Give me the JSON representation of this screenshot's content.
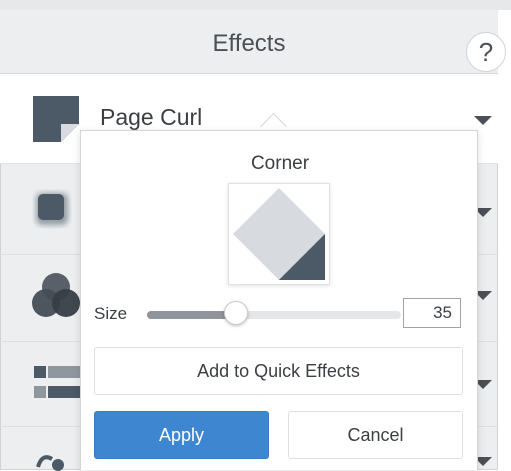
{
  "panel": {
    "title": "Effects",
    "help_label": "?"
  },
  "effects": [
    {
      "label": "Page Curl",
      "icon": "page-curl-icon",
      "expanded": true
    },
    {
      "label": "",
      "icon": "shadow-icon",
      "expanded": false
    },
    {
      "label": "",
      "icon": "color-blend-icon",
      "expanded": false
    },
    {
      "label": "",
      "icon": "torn-edge-icon",
      "expanded": false
    },
    {
      "label": "",
      "icon": "spotlight-icon",
      "expanded": false
    }
  ],
  "popover": {
    "corner_label": "Corner",
    "size_label": "Size",
    "size_value": "35",
    "size_fraction": 0.35,
    "quick_effects_label": "Add to Quick Effects",
    "apply_label": "Apply",
    "cancel_label": "Cancel"
  },
  "colors": {
    "accent": "#3f86d0",
    "icon_dark": "#4b5a66",
    "panel_bg": "#eceeef"
  }
}
